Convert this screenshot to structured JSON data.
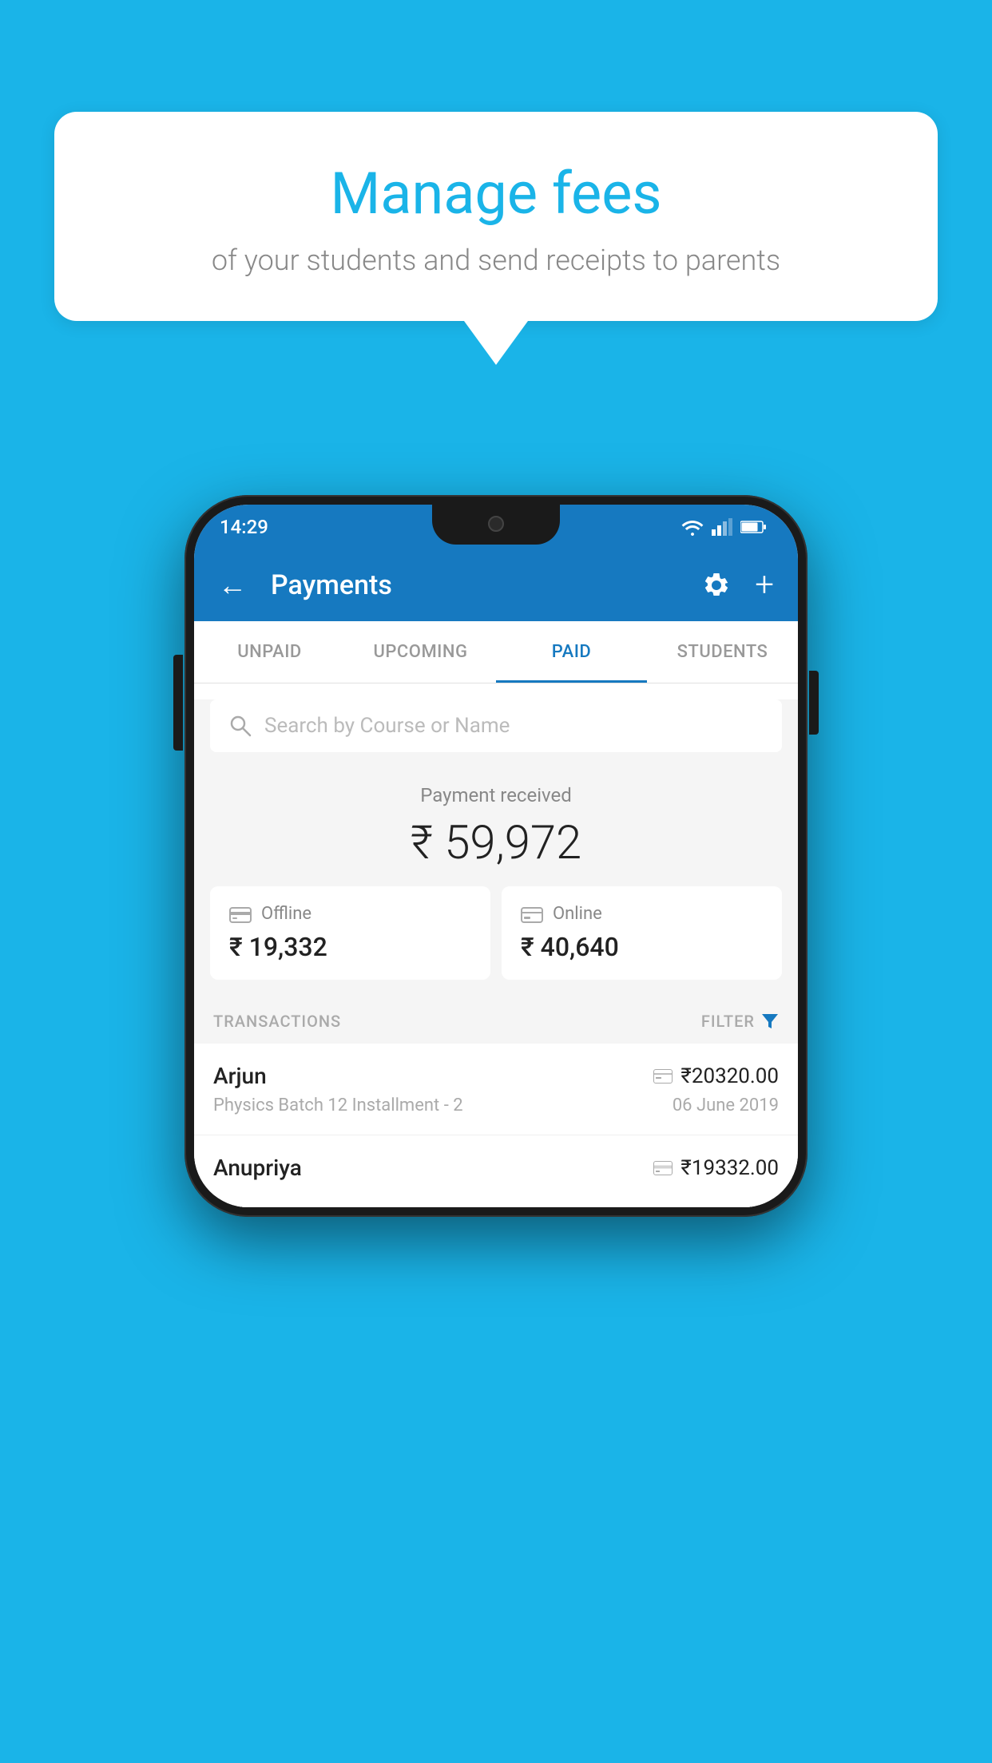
{
  "background": {
    "color": "#1ab4e8"
  },
  "speechBubble": {
    "title": "Manage fees",
    "subtitle": "of your students and send receipts to parents"
  },
  "phone": {
    "statusBar": {
      "time": "14:29",
      "icons": [
        "wifi",
        "signal",
        "battery"
      ]
    },
    "appBar": {
      "title": "Payments",
      "backLabel": "←",
      "settingsLabel": "⚙",
      "addLabel": "+"
    },
    "tabs": [
      {
        "id": "unpaid",
        "label": "UNPAID",
        "active": false
      },
      {
        "id": "upcoming",
        "label": "UPCOMING",
        "active": false
      },
      {
        "id": "paid",
        "label": "PAID",
        "active": true
      },
      {
        "id": "students",
        "label": "STUDENTS",
        "active": false
      }
    ],
    "search": {
      "placeholder": "Search by Course or Name"
    },
    "paymentSummary": {
      "label": "Payment received",
      "amount": "₹ 59,972",
      "offline": {
        "label": "Offline",
        "amount": "₹ 19,332"
      },
      "online": {
        "label": "Online",
        "amount": "₹ 40,640"
      }
    },
    "transactions": {
      "headerLabel": "TRANSACTIONS",
      "filterLabel": "FILTER",
      "items": [
        {
          "name": "Arjun",
          "amount": "₹20320.00",
          "course": "Physics Batch 12 Installment - 2",
          "date": "06 June 2019",
          "paymentType": "online"
        },
        {
          "name": "Anupriya",
          "amount": "₹19332.00",
          "course": "",
          "date": "",
          "paymentType": "offline"
        }
      ]
    }
  }
}
